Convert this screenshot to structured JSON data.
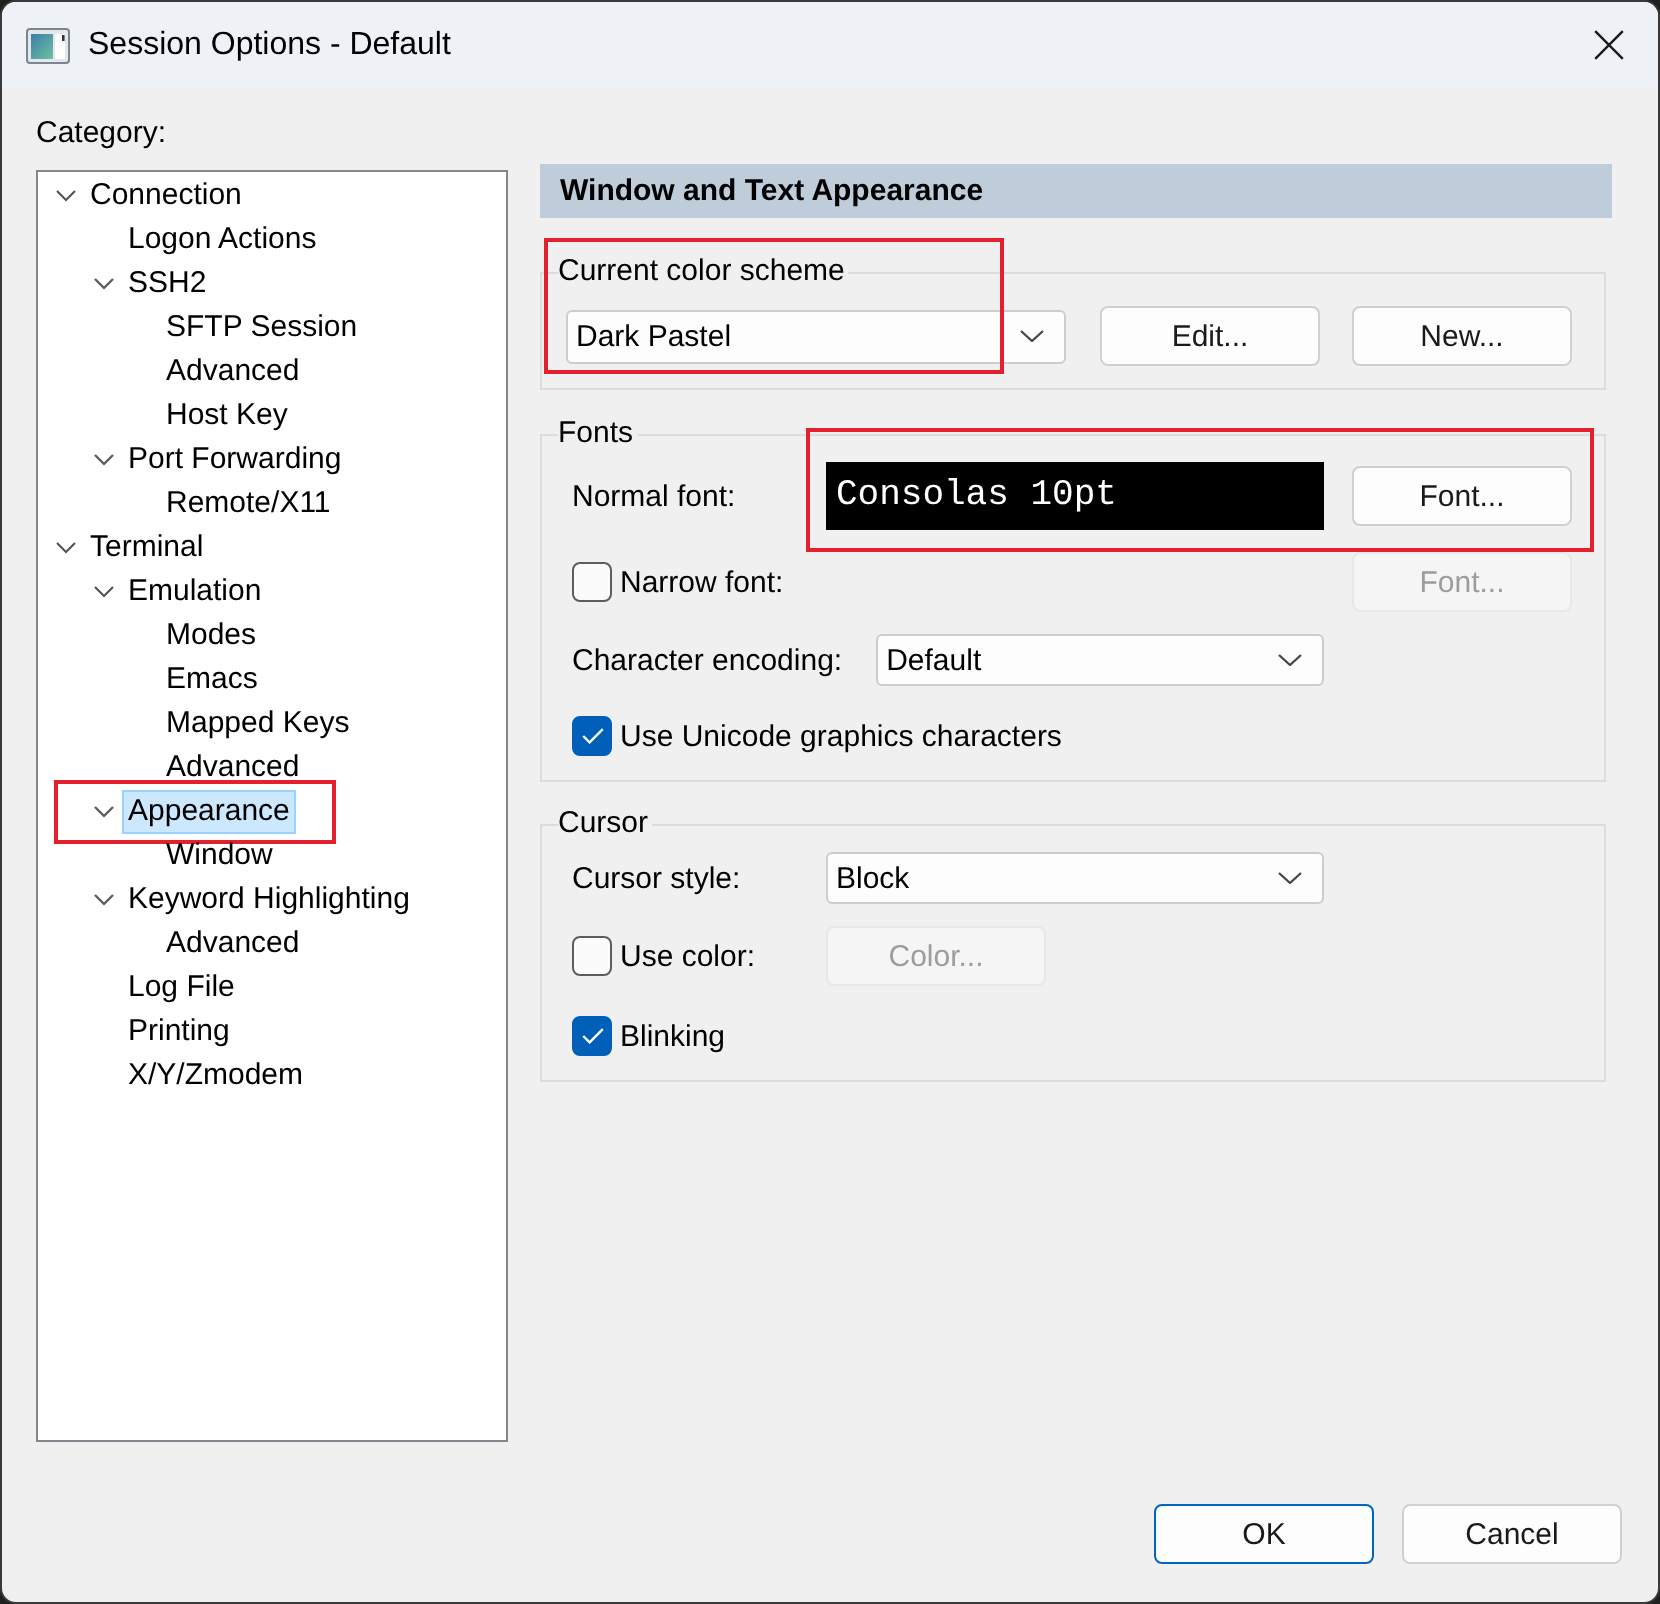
{
  "window": {
    "title": "Session Options - Default"
  },
  "category": {
    "label": "Category:",
    "tree": [
      {
        "label": "Connection",
        "expanded": true,
        "selected": false,
        "annotated": false,
        "children": [
          {
            "label": "Logon Actions",
            "selected": false,
            "annotated": false
          },
          {
            "label": "SSH2",
            "expanded": true,
            "selected": false,
            "annotated": false,
            "children": [
              {
                "label": "SFTP Session",
                "selected": false,
                "annotated": false
              },
              {
                "label": "Advanced",
                "selected": false,
                "annotated": false
              },
              {
                "label": "Host Key",
                "selected": false,
                "annotated": false
              }
            ]
          },
          {
            "label": "Port Forwarding",
            "expanded": true,
            "selected": false,
            "annotated": false,
            "children": [
              {
                "label": "Remote/X11",
                "selected": false,
                "annotated": false
              }
            ]
          }
        ]
      },
      {
        "label": "Terminal",
        "expanded": true,
        "selected": false,
        "annotated": false,
        "children": [
          {
            "label": "Emulation",
            "expanded": true,
            "selected": false,
            "annotated": false,
            "children": [
              {
                "label": "Modes",
                "selected": false,
                "annotated": false
              },
              {
                "label": "Emacs",
                "selected": false,
                "annotated": false
              },
              {
                "label": "Mapped Keys",
                "selected": false,
                "annotated": false
              },
              {
                "label": "Advanced",
                "selected": false,
                "annotated": false
              }
            ]
          },
          {
            "label": "Appearance",
            "expanded": true,
            "selected": true,
            "annotated": true,
            "children": [
              {
                "label": "Window",
                "selected": false,
                "annotated": false
              }
            ]
          },
          {
            "label": "Keyword Highlighting",
            "expanded": true,
            "selected": false,
            "annotated": false,
            "children": [
              {
                "label": "Advanced",
                "selected": false,
                "annotated": false
              }
            ]
          },
          {
            "label": "Log File",
            "selected": false,
            "annotated": false
          },
          {
            "label": "Printing",
            "selected": false,
            "annotated": false
          },
          {
            "label": "X/Y/Zmodem",
            "selected": false,
            "annotated": false
          }
        ]
      }
    ]
  },
  "panel": {
    "title": "Window and Text Appearance",
    "color_scheme": {
      "label": "Current color scheme",
      "annotated": true,
      "value": "Dark Pastel",
      "buttons": [
        {
          "label": "Edit...",
          "disabled": false
        },
        {
          "label": "New...",
          "disabled": false
        }
      ]
    },
    "groups": [
      {
        "label": "Fonts",
        "rows": [
          {
            "kind": "font",
            "label": "Normal font:",
            "value": "Consolas 10pt",
            "annotated": true,
            "button": {
              "label": "Font...",
              "disabled": false
            }
          },
          {
            "kind": "checkbox",
            "label": "Narrow font:",
            "checked": false,
            "annotated": false,
            "button": {
              "label": "Font...",
              "disabled": true
            }
          },
          {
            "kind": "dropdown",
            "label": "Character encoding:",
            "value": "Default",
            "annotated": false
          },
          {
            "kind": "checkbox",
            "label": "Use Unicode graphics characters",
            "checked": true,
            "annotated": false
          }
        ]
      },
      {
        "label": "Cursor",
        "rows": [
          {
            "kind": "dropdown",
            "label": "Cursor style:",
            "value": "Block",
            "annotated": false
          },
          {
            "kind": "checkbox",
            "label": "Use color:",
            "checked": false,
            "annotated": false,
            "button": {
              "label": "Color...",
              "disabled": true
            }
          },
          {
            "kind": "checkbox",
            "label": "Blinking",
            "checked": true,
            "annotated": false
          }
        ]
      }
    ]
  },
  "buttons": [
    {
      "label": "OK",
      "default": true
    },
    {
      "label": "Cancel",
      "default": false
    }
  ]
}
